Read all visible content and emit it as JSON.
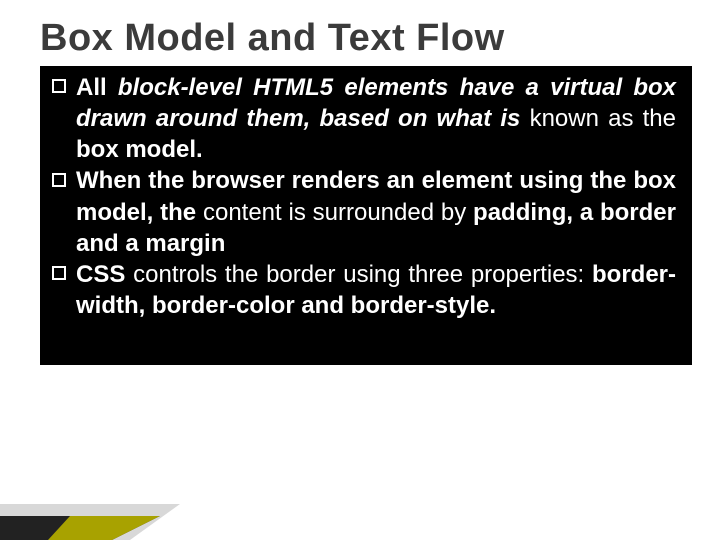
{
  "title": "Box Model and Text Flow",
  "bullets": [
    {
      "lead_bold": "All",
      "italic_run": " block-level HTML5 elements have a virtual box drawn around them, based on what is ",
      "tail_plain": "known as the ",
      "tail_bold": "box model."
    },
    {
      "lead_bold": "When the browser renders an element using the box model, the ",
      "mid_plain": "content is surrounded by ",
      "tail_bold": "padding, a border and a margin"
    },
    {
      "lead_bold": "CSS",
      "mid_plain": " controls the border using three properties: ",
      "tail_bold": "border-width, border-color and border-style."
    }
  ]
}
